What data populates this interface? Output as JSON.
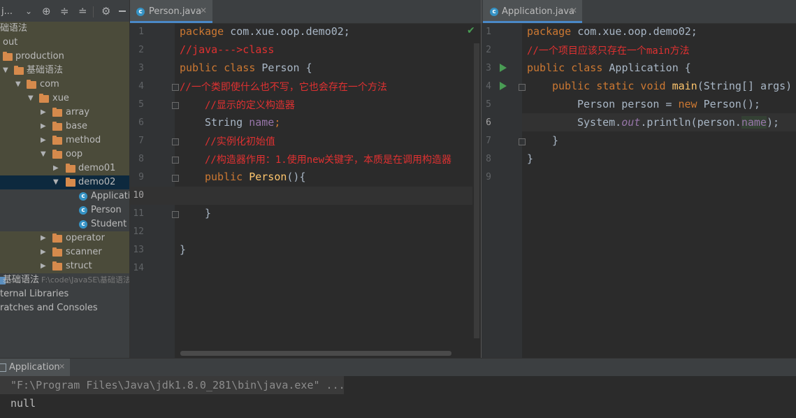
{
  "sidebar": {
    "toolbar_title": "j...",
    "tree": [
      {
        "label": "础语法",
        "hl": true
      },
      {
        "label": "out",
        "hl": true
      },
      {
        "label": "production",
        "hl": true
      },
      {
        "label": "基础语法",
        "hl": true
      },
      {
        "label": "com",
        "hl": true
      },
      {
        "label": "xue",
        "hl": true
      },
      {
        "label": "array",
        "hl": true
      },
      {
        "label": "base",
        "hl": true
      },
      {
        "label": "method",
        "hl": true
      },
      {
        "label": "oop",
        "hl": true
      },
      {
        "label": "demo01",
        "hl": true
      },
      {
        "label": "demo02",
        "sel": true
      },
      {
        "label": "Application"
      },
      {
        "label": "Person"
      },
      {
        "label": "Student"
      },
      {
        "label": "operator",
        "hl": true
      },
      {
        "label": "scanner",
        "hl": true
      },
      {
        "label": "struct",
        "hl": true
      },
      {
        "label": "基础语法",
        "path": "F:\\code\\JavaSE\\基础语法"
      },
      {
        "label": "ternal Libraries"
      },
      {
        "label": "ratches and Consoles"
      }
    ]
  },
  "editor_left": {
    "tab_title": "Person.java",
    "line_numbers": [
      "1",
      "2",
      "3",
      "4",
      "5",
      "6",
      "7",
      "8",
      "9",
      "10",
      "11",
      "12",
      "13",
      "14"
    ],
    "code": {
      "l1_kw": "package",
      "l1_rest": " com.xue.oop.demo02;",
      "l2": "//java--->class",
      "l3_kw": "public class",
      "l3_rest": " Person {",
      "l4": "//一个类即使什么也不写，它也会存在一个方法",
      "l5": "//显示的定义构造器",
      "l6_type": "String ",
      "l6_field": "name",
      "l6_semi": ";",
      "l7": "//实例化初始值",
      "l8": "//构造器作用：1.使用new关键字，本质是在调用构造器",
      "l9_kw": "public ",
      "l9_fn": "Person",
      "l9_rest": "(){",
      "l11": "}",
      "l13": "}"
    }
  },
  "editor_right": {
    "tab_title": "Application.java",
    "line_numbers": [
      "1",
      "2",
      "3",
      "4",
      "5",
      "6",
      "7",
      "8",
      "9"
    ],
    "code": {
      "l1_kw": "package",
      "l1_rest": " com.xue.oop.demo02;",
      "l2": "//一个项目应该只存在一个main方法",
      "l3_kw": "public class",
      "l3_rest": " Application {",
      "l4_kw": "public static void ",
      "l4_fn": "main",
      "l4_rest": "(String[] args)",
      "l5_a": "Person person = ",
      "l5_kw": "new",
      "l5_b": " Person();",
      "l6_a": "System.",
      "l6_out": "out",
      "l6_b": ".println(person.",
      "l6_field": "name",
      "l6_c": ");",
      "l7": "}",
      "l8": "}"
    }
  },
  "run_panel": {
    "tab_title": "Application",
    "console_lines": [
      "\"F:\\Program Files\\Java\\jdk1.8.0_281\\bin\\java.exe\" ...",
      "null"
    ]
  },
  "colors": {
    "keyword": "#cc7832",
    "comment": "#e03131",
    "field": "#9876aa",
    "method": "#ffc66d",
    "default_text": "#a9b7c6"
  },
  "icons": [
    "chevron-down-icon",
    "target-icon",
    "expand-all-icon",
    "collapse-all-icon",
    "gear-icon",
    "class-icon",
    "folder-icon",
    "run-icon",
    "check-icon",
    "close-icon"
  ]
}
